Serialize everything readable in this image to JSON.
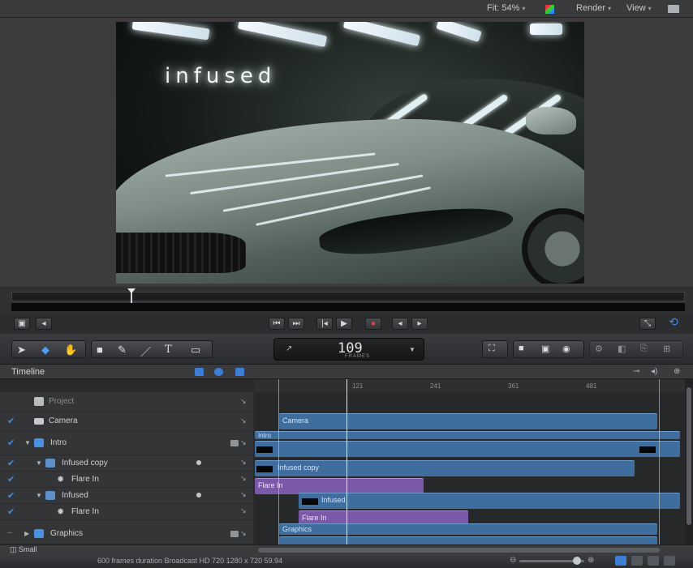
{
  "topbar": {
    "fit_label": "Fit: 54%",
    "render_label": "Render",
    "view_label": "View"
  },
  "viewer": {
    "overlay_text": "infused"
  },
  "toolbar": {
    "timecode_value": "109",
    "timecode_unit": "FRAMES"
  },
  "timeline": {
    "title": "Timeline",
    "ruler_ticks": [
      "121",
      "241",
      "361",
      "481"
    ],
    "layers": [
      {
        "name": "Project",
        "checked": false,
        "dim": true
      },
      {
        "name": "Camera",
        "checked": true
      },
      {
        "name": "Intro",
        "checked": true
      },
      {
        "name": "Infused copy",
        "checked": true
      },
      {
        "name": "Flare In",
        "checked": true
      },
      {
        "name": "Infused",
        "checked": true
      },
      {
        "name": "Flare In",
        "checked": true
      },
      {
        "name": "Graphics",
        "checked": true
      }
    ],
    "tracks": {
      "camera": "Camera",
      "intro": "Intro",
      "infused_copy": "Infused copy",
      "flare_in_1": "Flare In",
      "infused": "Infused",
      "flare_in_2": "Flare In",
      "graphics": "Graphics"
    },
    "footer_label": "Small"
  },
  "status": {
    "text": "600 frames duration Broadcast HD 720 1280 x 720 59.94"
  },
  "colors": {
    "accent": "#3d7fd6",
    "track_blue": "#3f6d9e",
    "track_purple": "#7a5aa8",
    "record": "#e2453c"
  }
}
